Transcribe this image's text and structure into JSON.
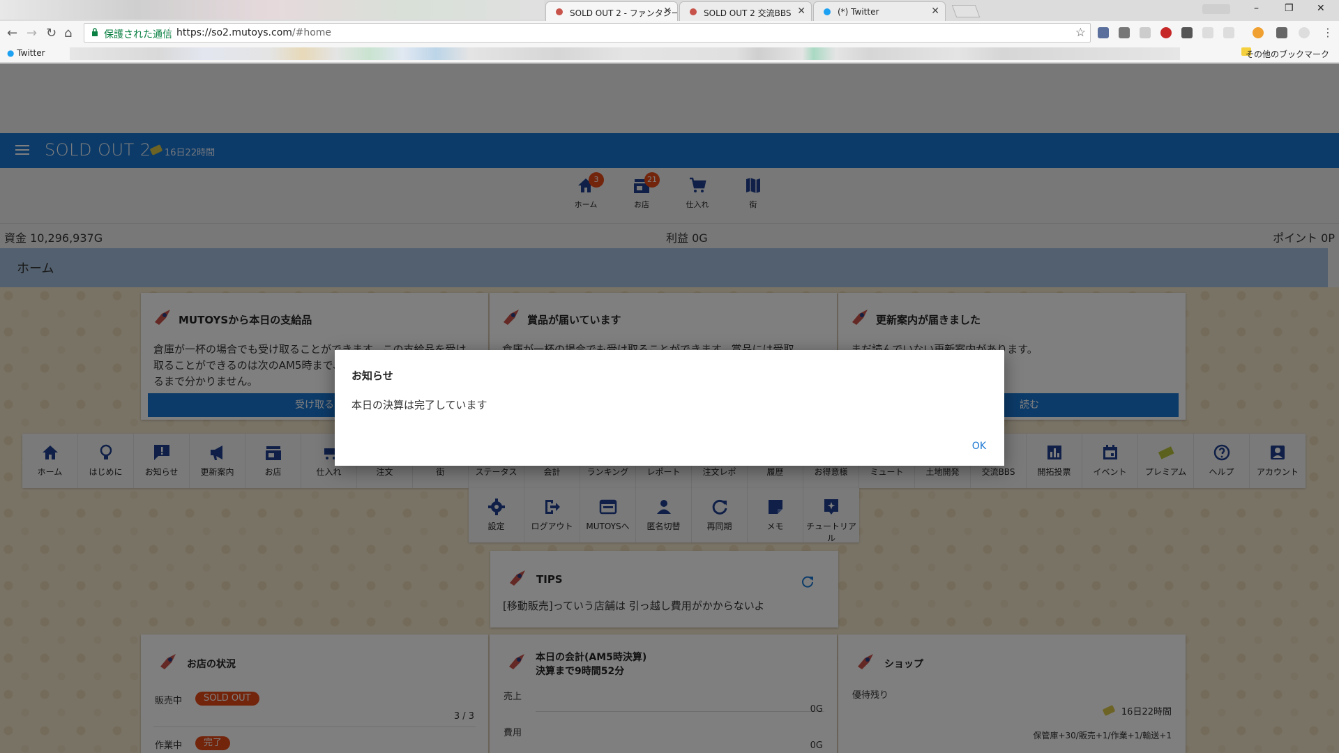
{
  "browser": {
    "tabs": [
      {
        "title": "SOLD OUT 2 - ファンタジー",
        "close": "✕"
      },
      {
        "title": "SOLD OUT 2 交流BBS",
        "close": "✕"
      },
      {
        "title": "(*) Twitter",
        "close": "✕"
      }
    ],
    "omnibox": {
      "secure_label": "保護された通信",
      "url_host": "https://so2.mutoys.com",
      "url_path": "/#home"
    },
    "bookmarks": {
      "twitter": "Twitter",
      "other": "その他のブックマーク"
    },
    "window_buttons": {
      "minimize": "–",
      "restore": "❐",
      "close": "✕"
    }
  },
  "app": {
    "title": "SOLD OUT 2",
    "timer": "16日22時間",
    "nav": [
      {
        "label": "ホーム",
        "icon": "home-icon",
        "badge": "3"
      },
      {
        "label": "お店",
        "icon": "store-icon",
        "badge": "21"
      },
      {
        "label": "仕入れ",
        "icon": "cart-icon",
        "badge": ""
      },
      {
        "label": "街",
        "icon": "map-icon",
        "badge": ""
      }
    ],
    "stats": {
      "money": "資金 10,296,937G",
      "profit": "利益 0G",
      "points": "ポイント 0P"
    },
    "page_title": "ホーム"
  },
  "cards": {
    "supply": {
      "title": "MUTOYSから本日の支給品",
      "text": "倉庫が一杯の場合でも受け取ることができます。この支給品を受け取ることができるのは次のAM5時まで、何が受け取れるかは受け取るまで分かりません。",
      "button": "受け取る"
    },
    "prize": {
      "title": "賞品が届いています",
      "text": "倉庫が一杯の場合でも受け取ることができます。賞品には受取",
      "button": ""
    },
    "update": {
      "title": "更新案内が届きました",
      "text": "まだ読んでいない更新案内があります。",
      "button": "読む"
    }
  },
  "menu_row1": [
    "ホーム",
    "はじめに",
    "お知らせ",
    "更新案内",
    "お店",
    "仕入れ",
    "注文",
    "街",
    "ステータス",
    "会計",
    "ランキング",
    "レポート",
    "注文レポ",
    "履歴",
    "お得意様",
    "ミュート",
    "土地開発",
    "交流BBS",
    "開拓投票",
    "イベント",
    "プレミアム",
    "ヘルプ",
    "アカウント"
  ],
  "menu_row2": [
    "設定",
    "ログアウト",
    "MUTOYSへ",
    "匿名切替",
    "再同期",
    "メモ",
    "チュートリアル"
  ],
  "tips": {
    "title": "TIPS",
    "text": "[移動販売]っていう店舗は 引っ越し費用がかからないよ"
  },
  "shop_status": {
    "title": "お店の状況",
    "selling_label": "販売中",
    "selling_badge": "SOLD OUT",
    "count": "3 / 3",
    "work_label": "作業中",
    "work_badge": "完了"
  },
  "accounting": {
    "title": "本日の会計(AM5時決算)",
    "subtitle": "決算まで9時間52分",
    "sales_label": "売上",
    "sales_value": "0G",
    "cost_label": "費用",
    "cost_value": "0G"
  },
  "shop": {
    "title": "ショップ",
    "remaining_label": "優待残り",
    "timer": "16日22時間",
    "perks": "保管庫+30/販売+1/作業+1/輸送+1"
  },
  "dialog": {
    "title": "お知らせ",
    "body": "本日の決算は完了しています",
    "ok": "OK"
  },
  "colors": {
    "primary": "#1976d2",
    "accent": "#e64a19",
    "page_header": "#a7c1de"
  }
}
